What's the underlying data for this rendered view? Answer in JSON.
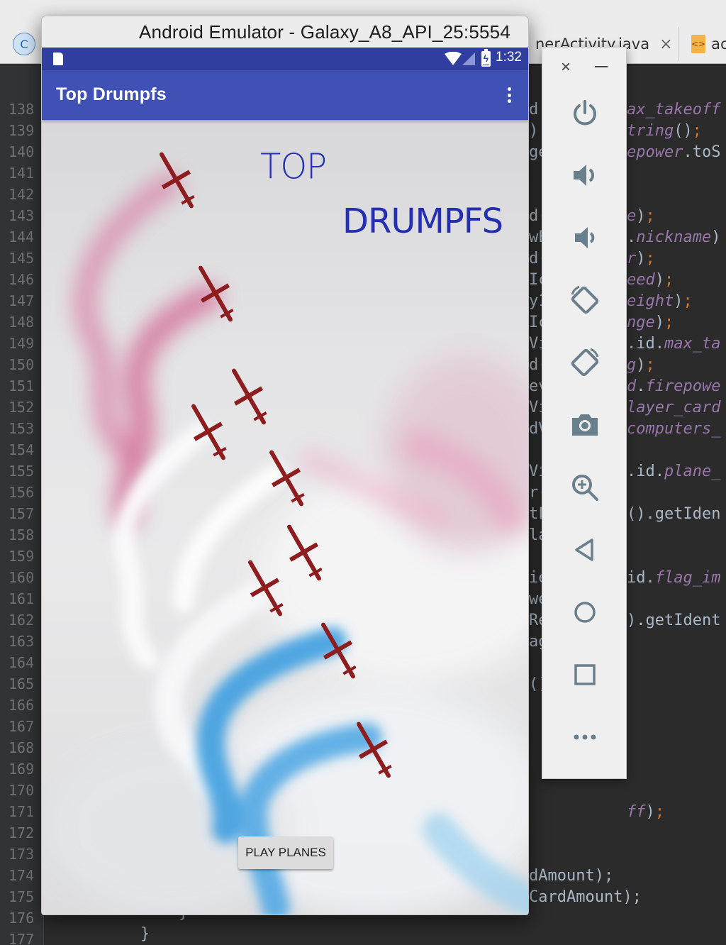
{
  "ide": {
    "tabs": [
      {
        "label": "nerActivity.java",
        "close": "×"
      },
      {
        "label": "ac"
      }
    ],
    "line_numbers": [
      "138",
      "139",
      "140",
      "141",
      "142",
      "143",
      "144",
      "145",
      "146",
      "147",
      "148",
      "149",
      "150",
      "151",
      "152",
      "153",
      "154",
      "155",
      "156",
      "157",
      "158",
      "159",
      "160",
      "161",
      "162",
      "163",
      "164",
      "165",
      "166",
      "167",
      "168",
      "169",
      "170",
      "171",
      "172",
      "173",
      "174",
      "175",
      "176",
      "177"
    ],
    "code_left_fragments": [
      "d.",
      ").",
      "ge",
      "",
      "",
      "d(",
      "wE",
      "d(",
      "Ic",
      "y1",
      "Ic",
      "Vi",
      "d(",
      "ev",
      "Vi",
      "dV",
      "",
      "Vi",
      "r(",
      "tF",
      "la",
      "",
      "ie",
      "we",
      "Re",
      "ag",
      "",
      "()",
      "",
      "",
      "",
      "",
      "",
      "",
      "",
      "",
      "dAmount);",
      "CardAmount);",
      "",
      ""
    ],
    "code_right_fragments": {
      "138": "ax_takeoff",
      "139": "tring();",
      "140": "epower.toS",
      "143": "e);",
      "144": ".nickname)",
      "145": "r);",
      "146": "eed);",
      "147": "eight);",
      "148": "nge);",
      "149": ".id.max_ta",
      "150": "g);",
      "151": "d.firepowe",
      "152": "layer_card",
      "153": "computers_",
      "155": ".id.plane_",
      "157": "().getIden",
      "160": "id.flag_im",
      "162": ").getIdent",
      "171": "ff);"
    },
    "closing_braces": [
      "}",
      "}"
    ]
  },
  "emulator": {
    "window_title": "Android Emulator - Galaxy_A8_API_25:5554",
    "status_bar": {
      "time": "1:32"
    },
    "app_bar": {
      "title": "Top Drumpfs"
    },
    "content": {
      "title_line1": "TOP",
      "title_line2": "DRUMPFS",
      "play_button": "PLAY PLANES"
    },
    "toolbar": {
      "buttons": [
        "power-icon",
        "volume-up-icon",
        "volume-down-icon",
        "rotate-left-icon",
        "rotate-right-icon",
        "camera-icon",
        "zoom-icon",
        "back-icon",
        "home-icon",
        "overview-icon",
        "more-icon"
      ]
    }
  },
  "colors": {
    "status_bar": "#303f9f",
    "app_bar": "#3f51b5",
    "title_text": "#2430b0",
    "ide_background": "#2b2b2b"
  }
}
